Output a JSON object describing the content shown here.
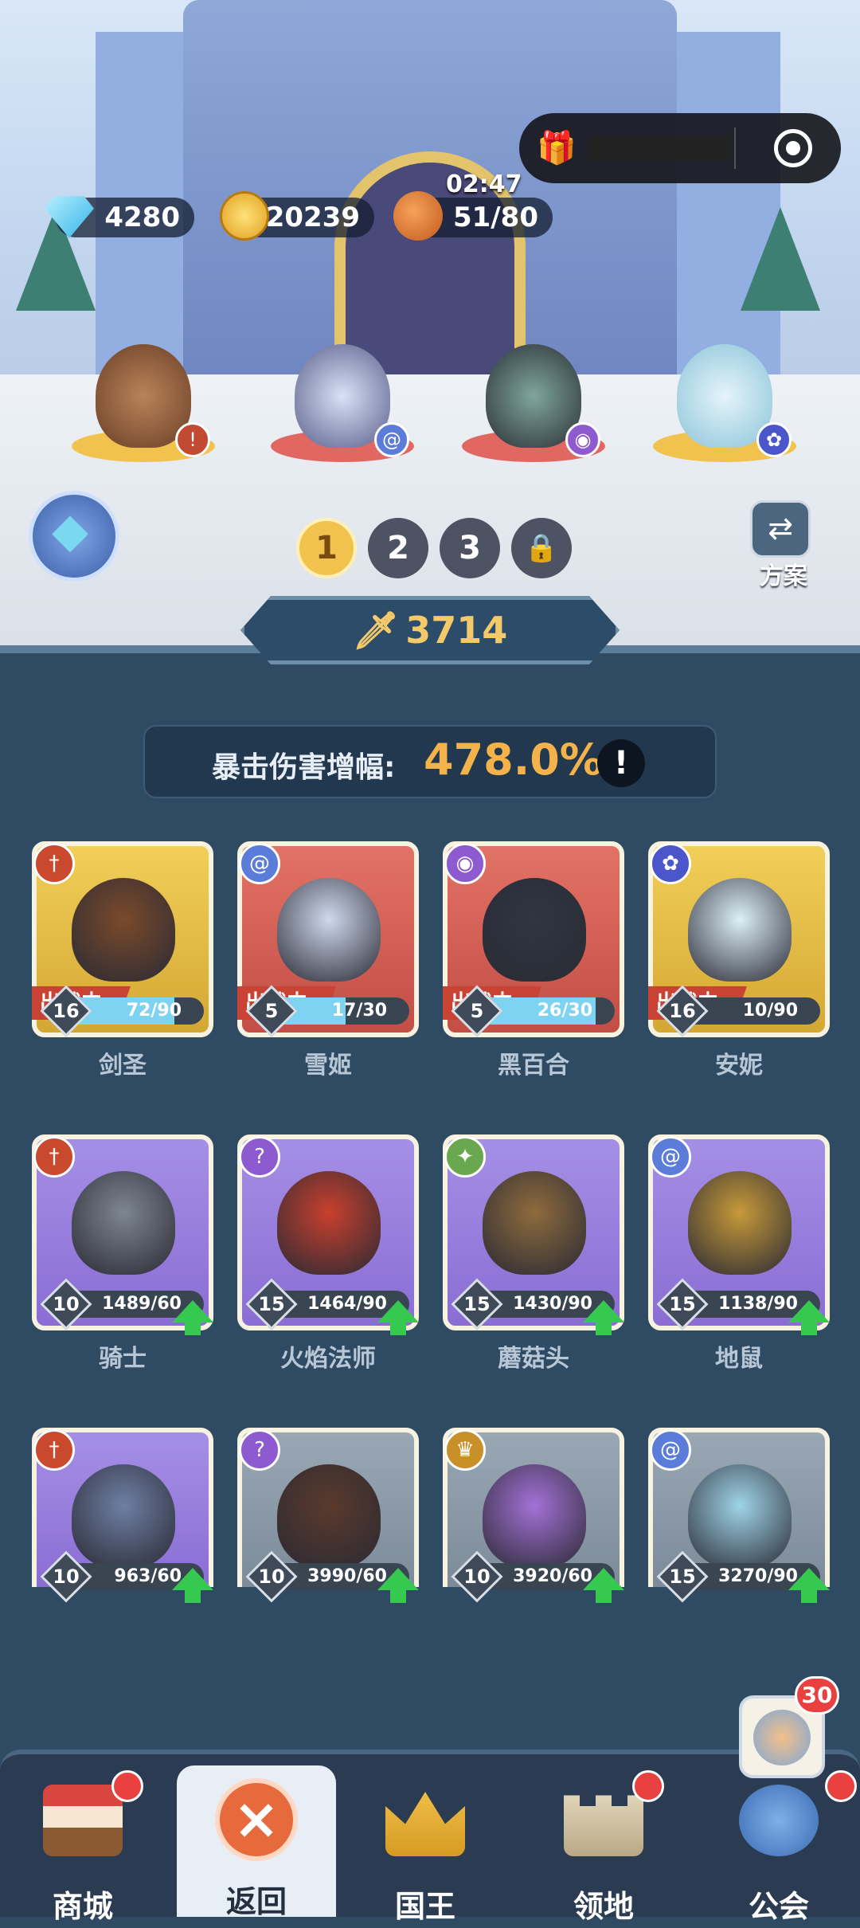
{
  "resources": {
    "gems": "4280",
    "coins": "20239",
    "stamina": "51/80",
    "timer": "02:47"
  },
  "teams": {
    "slots": [
      "1",
      "2",
      "3"
    ],
    "active": "1"
  },
  "plan_label": "方案",
  "power": "3714",
  "crit": {
    "label": "暴击伤害增幅:",
    "value": "478.0%",
    "info": "!"
  },
  "in_battle_label": "出战中",
  "cards": [
    {
      "name": "剑圣",
      "level": "16",
      "progress": "72/90",
      "fill": 0.8,
      "color": "gold",
      "type_icon": "sword-icon",
      "deployed": true
    },
    {
      "name": "雪姬",
      "level": "5",
      "progress": "17/30",
      "fill": 0.57,
      "color": "red",
      "type_icon": "swirl-icon",
      "deployed": true
    },
    {
      "name": "黑百合",
      "level": "5",
      "progress": "26/30",
      "fill": 0.87,
      "color": "red",
      "type_icon": "eye-icon",
      "deployed": true
    },
    {
      "name": "安妮",
      "level": "16",
      "progress": "10/90",
      "fill": 0.11,
      "color": "gold",
      "type_icon": "paw-icon",
      "deployed": true
    },
    {
      "name": "骑士",
      "level": "10",
      "progress": "1489/60",
      "fill": 1,
      "color": "purple",
      "type_icon": "sword-icon",
      "upgrade": true
    },
    {
      "name": "火焰法师",
      "level": "15",
      "progress": "1464/90",
      "fill": 1,
      "color": "purple",
      "type_icon": "staff-icon",
      "upgrade": true
    },
    {
      "name": "蘑菇头",
      "level": "15",
      "progress": "1430/90",
      "fill": 1,
      "color": "purple",
      "type_icon": "star-icon",
      "upgrade": true
    },
    {
      "name": "地鼠",
      "level": "15",
      "progress": "1138/90",
      "fill": 1,
      "color": "purple",
      "type_icon": "swirl-icon",
      "upgrade": true
    },
    {
      "name": "",
      "level": "10",
      "progress": "963/60",
      "fill": 1,
      "color": "purple",
      "type_icon": "sword-icon",
      "upgrade": true
    },
    {
      "name": "",
      "level": "10",
      "progress": "3990/60",
      "fill": 1,
      "color": "gray",
      "type_icon": "staff-icon",
      "upgrade": true
    },
    {
      "name": "",
      "level": "10",
      "progress": "3920/60",
      "fill": 1,
      "color": "gray",
      "type_icon": "crown-icon",
      "upgrade": true
    },
    {
      "name": "",
      "level": "15",
      "progress": "3270/90",
      "fill": 1,
      "color": "gray",
      "type_icon": "swirl-icon",
      "upgrade": true
    }
  ],
  "nav": {
    "shop": "商城",
    "back": "返回",
    "king": "国王",
    "territory": "领地",
    "guild": "公会",
    "guild_badge": "30"
  },
  "colors": {
    "accent_gold": "#f3c969",
    "alert_red": "#e94040",
    "upgrade_green": "#35c94f"
  }
}
